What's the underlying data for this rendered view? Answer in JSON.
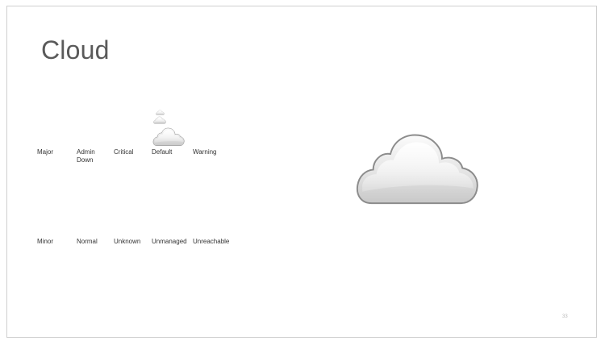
{
  "slide": {
    "title": "Cloud",
    "page_number": "33"
  },
  "states_row1": [
    {
      "key": "major",
      "label": "Major"
    },
    {
      "key": "admin-down",
      "label": "Admin\nDown"
    },
    {
      "key": "critical",
      "label": "Critical"
    },
    {
      "key": "default",
      "label": "Default"
    },
    {
      "key": "warning",
      "label": "Warning"
    }
  ],
  "states_row2": [
    {
      "key": "minor",
      "label": "Minor"
    },
    {
      "key": "normal",
      "label": "Normal"
    },
    {
      "key": "unknown",
      "label": "Unknown"
    },
    {
      "key": "unmanaged",
      "label": "Unmanaged"
    },
    {
      "key": "unreachable",
      "label": "Unreachable"
    }
  ],
  "icons": {
    "cloud": "cloud-icon",
    "fill_top": "#ffffff",
    "fill_bottom": "#c9c9c9",
    "outline": "#8c8c8c"
  }
}
